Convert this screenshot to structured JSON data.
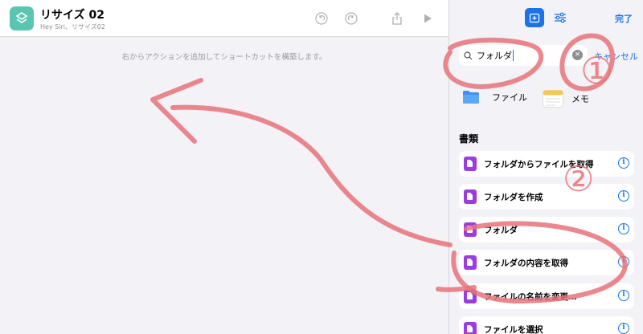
{
  "shortcut": {
    "title": "リサイズ 02",
    "subtitle": "Hey Siri、リサイズ02"
  },
  "toolbar": {
    "icons": [
      "undo-icon",
      "redo-icon",
      "share-icon",
      "play-icon"
    ]
  },
  "canvas": {
    "hint": "右からアクションを追加してショートカットを構築します。"
  },
  "sidebar": {
    "done_label": "完了",
    "search": {
      "value": "フォルダ"
    },
    "cancel_label": "キャンセル",
    "apps": [
      {
        "label": "ファイル",
        "icon": "folder-icon"
      },
      {
        "label": "メモ",
        "icon": "notes-icon"
      }
    ],
    "section_title": "書類",
    "actions": [
      {
        "label": "フォルダからファイルを取得"
      },
      {
        "label": "フォルダを作成"
      },
      {
        "label": "フォルダ"
      },
      {
        "label": "フォルダの内容を取得"
      },
      {
        "label": "ファイルの名前を変更…"
      },
      {
        "label": "ファイルを選択"
      }
    ]
  },
  "annotations": {
    "marks": [
      "①",
      "②"
    ]
  },
  "colors": {
    "accent": "#1a73e8",
    "action_icon": "#9b3ce0",
    "annotation": "#e8737a",
    "app_icon": "#5ac6b0"
  }
}
